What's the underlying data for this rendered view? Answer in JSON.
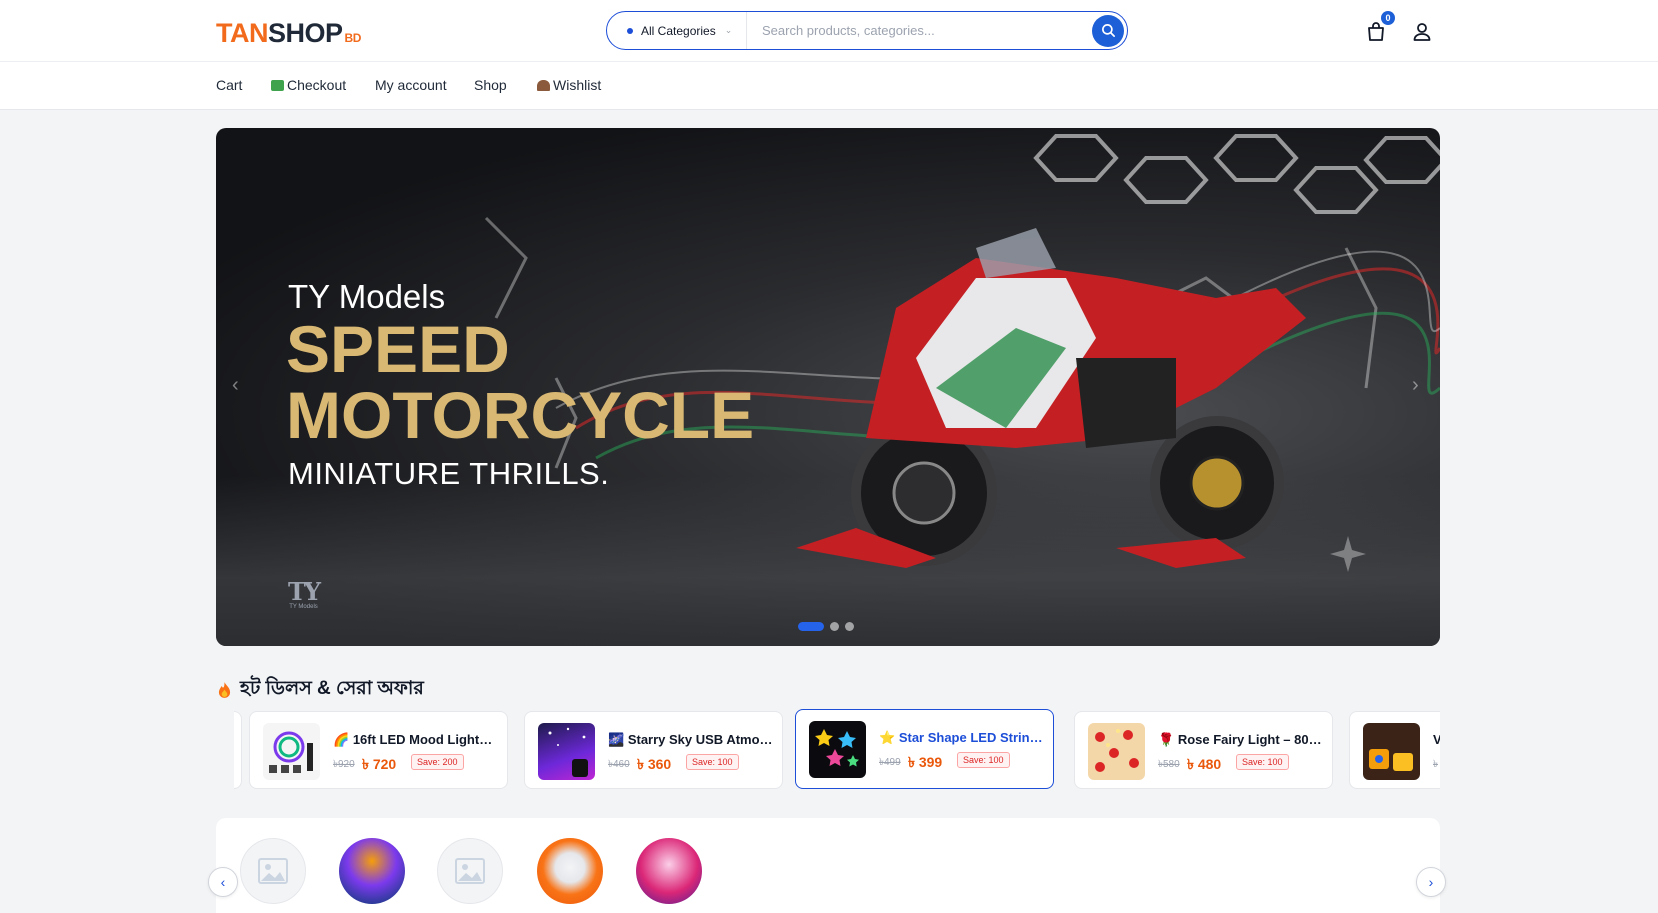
{
  "header": {
    "logo": {
      "part1": "TAN",
      "part2": "SHOP",
      "suffix": "BD"
    },
    "search": {
      "category_label": "All Categories",
      "placeholder": "Search products, categories..."
    },
    "cart_count": "0"
  },
  "nav": {
    "items": [
      {
        "label": "Cart"
      },
      {
        "label": "Checkout",
        "icon": "money-icon"
      },
      {
        "label": "My account"
      },
      {
        "label": "Shop"
      },
      {
        "label": "Wishlist",
        "icon": "hut-icon"
      }
    ]
  },
  "hero": {
    "subtitle": "TY Models",
    "title_line1": "SPEED",
    "title_line2": "MOTORCYCLE",
    "tagline": "MINIATURE THRILLS.",
    "brand_mark": "TY",
    "brand_small": "TY Models",
    "slides": 3,
    "active_slide": 1
  },
  "deals": {
    "title": "হট ডিলস & সেরা অফার",
    "items": [
      {
        "icon": "🌈",
        "name": "16ft LED Mood Lights – ...",
        "old_price": "৳920",
        "price": "৳ 720",
        "save": "Save: 200"
      },
      {
        "icon": "🌌",
        "name": "Starry Sky USB Atmosp...",
        "old_price": "৳460",
        "price": "৳ 360",
        "save": "Save: 100"
      },
      {
        "icon": "⭐",
        "name": "Star Shape LED String Li...",
        "old_price": "৳499",
        "price": "৳ 399",
        "save": "Save: 100"
      },
      {
        "icon": "🌹",
        "name": "Rose Fairy Light – 80 LE...",
        "old_price": "৳580",
        "price": "৳ 480",
        "save": "Save: 100"
      },
      {
        "icon": "",
        "name": "V",
        "old_price": "৳",
        "price": "",
        "save": ""
      }
    ]
  },
  "colors": {
    "brand_orange": "#f26b1d",
    "brand_blue": "#1d4ed8",
    "price_orange": "#ea580c",
    "hero_gold": "#d8b873"
  }
}
